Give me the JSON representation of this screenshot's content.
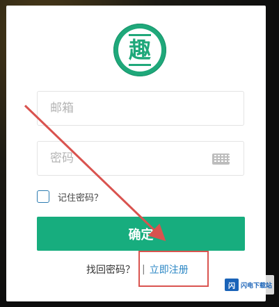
{
  "logo": {
    "glyph": "趣",
    "color": "#1fa87a"
  },
  "form": {
    "email_placeholder": "邮箱",
    "password_placeholder": "密码",
    "keyboard_icon": "keyboard-icon",
    "remember_label": "记住密码？",
    "remember_checked": false,
    "confirm_label": "确定"
  },
  "links": {
    "forgot_label": "找回密码？",
    "separator": "|",
    "register_label": "立即注册"
  },
  "annotation": {
    "highlight_color": "#d9534f",
    "arrow_color": "#d9534f"
  },
  "watermark": {
    "logo_text": "闪",
    "text": "闪电下载站"
  },
  "colors": {
    "primary": "#17ad7e",
    "link": "#2a86c4"
  }
}
